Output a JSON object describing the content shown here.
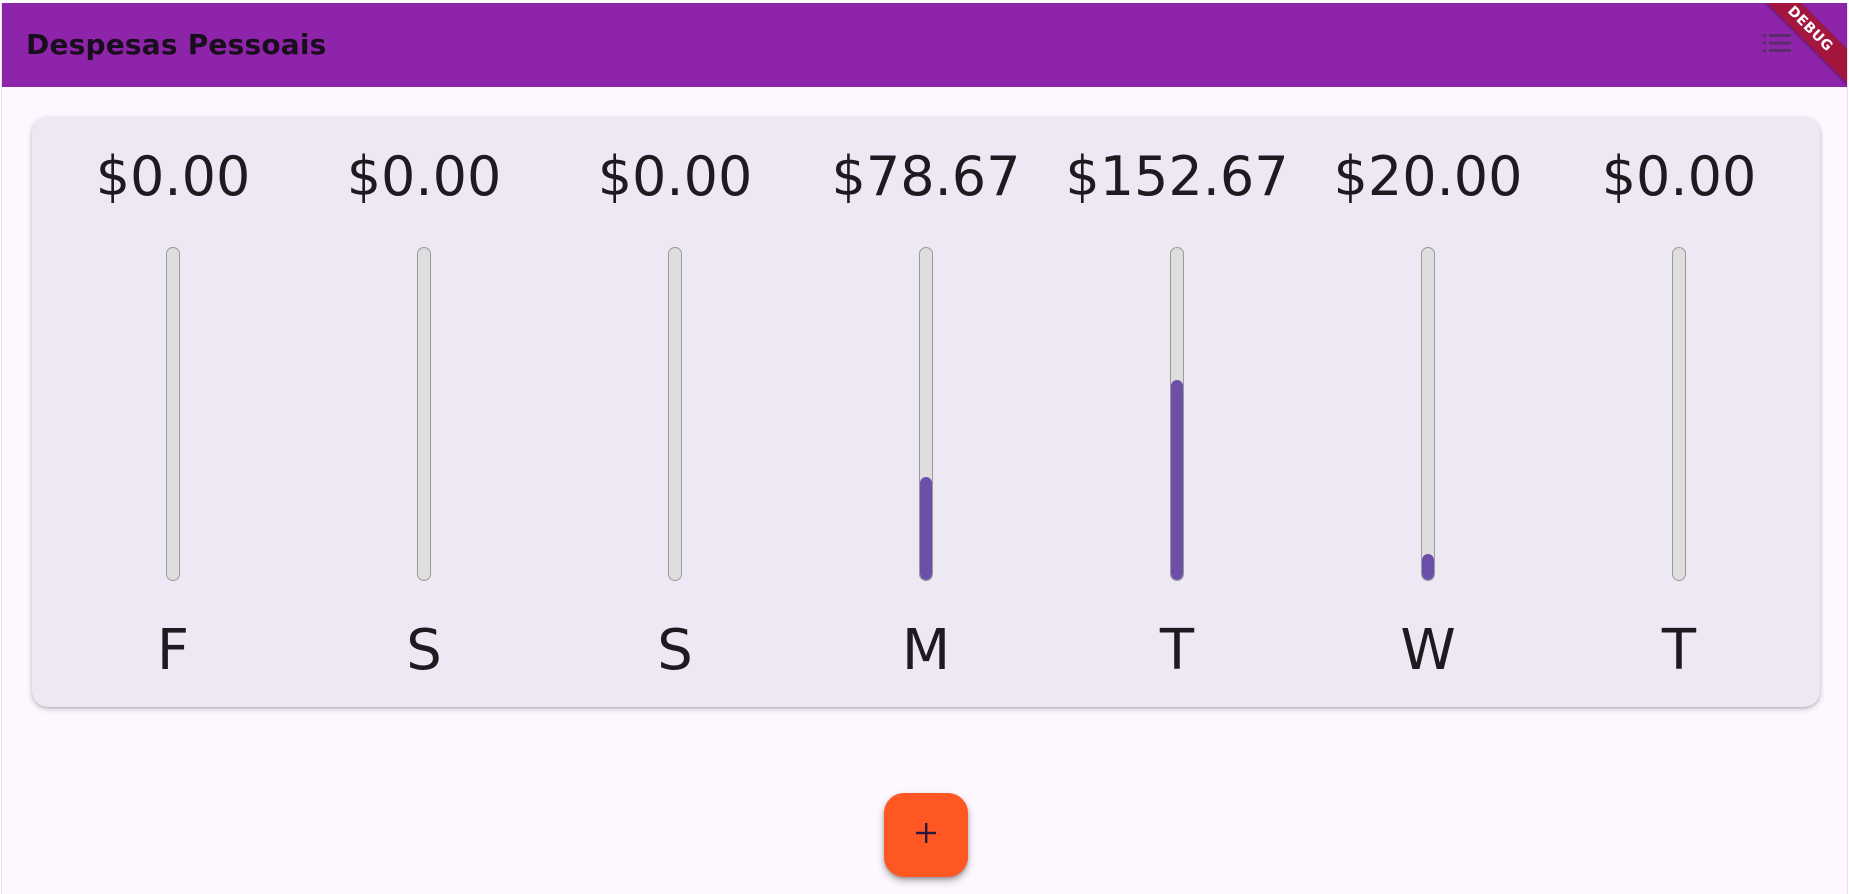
{
  "app_bar": {
    "title": "Despesas Pessoais",
    "background_color": "#8e24aa",
    "actions": [
      {
        "icon": "list-icon"
      }
    ],
    "debug_banner": "DEBUG"
  },
  "chart": {
    "bar_fill_color": "#6b4fa8",
    "bar_track_color": "#dedede",
    "days": [
      {
        "label": "F",
        "amount": "$0.00",
        "fraction": 0
      },
      {
        "label": "S",
        "amount": "$0.00",
        "fraction": 0
      },
      {
        "label": "S",
        "amount": "$0.00",
        "fraction": 0
      },
      {
        "label": "M",
        "amount": "$78.67",
        "fraction": 0.311
      },
      {
        "label": "T",
        "amount": "$152.67",
        "fraction": 0.603
      },
      {
        "label": "W",
        "amount": "$20.00",
        "fraction": 0.079
      },
      {
        "label": "T",
        "amount": "$0.00",
        "fraction": 0
      }
    ]
  },
  "fab": {
    "icon": "plus-icon",
    "background_color": "#ff5722"
  }
}
